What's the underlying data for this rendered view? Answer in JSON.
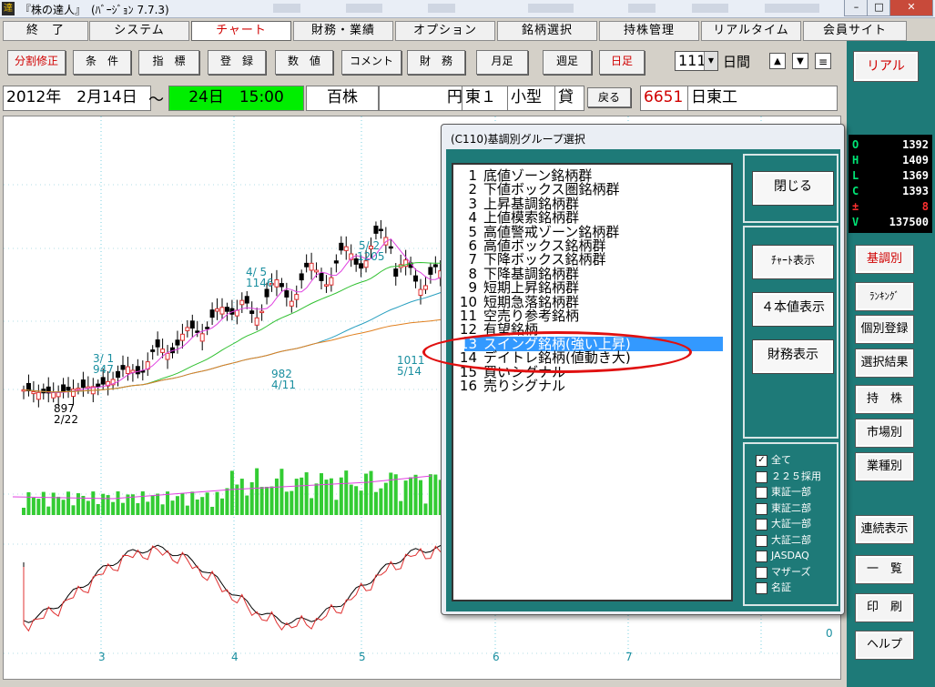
{
  "window": {
    "title": "『株の達人』　(ﾊﾞｰｼﾞｮﾝ 7.7.3)",
    "logo": "達",
    "controls": [
      "–",
      "□",
      "✕"
    ]
  },
  "menubar": [
    "終　了",
    "システム",
    "チャート",
    "財務・業績",
    "オプション",
    "銘柄選択",
    "持株管理",
    "リアルタイム",
    "会員サイト"
  ],
  "toolbar": {
    "buttons": [
      "分割修正",
      "条　件",
      "指　標",
      "登　録",
      "数　値",
      "コメント",
      "財　務",
      "月足",
      "週足",
      "日足"
    ],
    "period_value": "111",
    "period_unit": "日間",
    "arrow_up": "▲",
    "arrow_down": "▼",
    "menu_glyph": "≡"
  },
  "inforow": {
    "date_from": "2012年　2月14日",
    "tilde": "～",
    "date_to": "24日　15:00",
    "unit_shares": "百株",
    "currency": "円",
    "market": "東１",
    "size": "小型",
    "margin": "貸",
    "back_button": "戻る",
    "code": "6651",
    "name": "日東工"
  },
  "chart": {
    "annotations": [
      "897",
      "2/22",
      "3/ 1",
      "947",
      "4/ 5",
      "1146",
      "5/ 2",
      "1205",
      "982",
      "4/11",
      "1011",
      "5/14"
    ],
    "x_months": [
      "3",
      "4",
      "5",
      "6",
      "7"
    ],
    "zero_label": "0"
  },
  "quote": {
    "rows": [
      {
        "k": "O",
        "v": "1392"
      },
      {
        "k": "H",
        "v": "1409"
      },
      {
        "k": "L",
        "v": "1369"
      },
      {
        "k": "C",
        "v": "1393"
      },
      {
        "k": "±",
        "v": "8"
      },
      {
        "k": "V",
        "v": "137500"
      }
    ]
  },
  "rightpanel": {
    "buttons": [
      "リアル",
      "基調別",
      "ﾗﾝｷﾝｸﾞ",
      "個別登録",
      "選択結果",
      "持　株",
      "市場別",
      "業種別",
      "連続表示",
      "一　覧",
      "印　刷",
      "ヘルプ"
    ]
  },
  "dialog": {
    "title": "(C110)基調別グループ選択",
    "items": [
      {
        "n": "1",
        "t": "底値ゾーン銘柄群"
      },
      {
        "n": "2",
        "t": "下値ボックス圏銘柄群"
      },
      {
        "n": "3",
        "t": "上昇基調銘柄群"
      },
      {
        "n": "4",
        "t": "上値模索銘柄群"
      },
      {
        "n": "5",
        "t": "高値警戒ゾーン銘柄群"
      },
      {
        "n": "6",
        "t": "高値ボックス銘柄群"
      },
      {
        "n": "7",
        "t": "下降ボックス銘柄群"
      },
      {
        "n": "8",
        "t": "下降基調銘柄群"
      },
      {
        "n": "9",
        "t": "短期上昇銘柄群"
      },
      {
        "n": "10",
        "t": "短期急落銘柄群"
      },
      {
        "n": "11",
        "t": "空売り参考銘柄"
      },
      {
        "n": "12",
        "t": "有望銘柄"
      },
      {
        "n": "13",
        "t": "スイング銘柄(強い上昇)"
      },
      {
        "n": "14",
        "t": "デイトレ銘柄(値動き大)"
      },
      {
        "n": "15",
        "t": "買いシグナル"
      },
      {
        "n": "16",
        "t": "売りシグナル"
      }
    ],
    "selected_index": 12,
    "buttons": [
      "閉じる",
      "ﾁｬｰﾄ表示",
      "４本値表示",
      "財務表示"
    ],
    "markets": [
      {
        "label": "全て",
        "checked": true
      },
      {
        "label": "２２５採用",
        "checked": false
      },
      {
        "label": "東証一部",
        "checked": false
      },
      {
        "label": "東証二部",
        "checked": false
      },
      {
        "label": "大証一部",
        "checked": false
      },
      {
        "label": "大証二部",
        "checked": false
      },
      {
        "label": "JASDAQ",
        "checked": false
      },
      {
        "label": "マザーズ",
        "checked": false
      },
      {
        "label": "名証",
        "checked": false
      }
    ]
  },
  "colors": {
    "teal": "#1e7a78",
    "price_up": "#e03030",
    "volume": "#33cc33",
    "ma_short": "#e040e0",
    "ma_mid": "#30c030",
    "ma_long": "#2aa0c0",
    "ma_longest": "#e08020",
    "highlight": "#3399ff",
    "time_bg": "#00ee00"
  }
}
